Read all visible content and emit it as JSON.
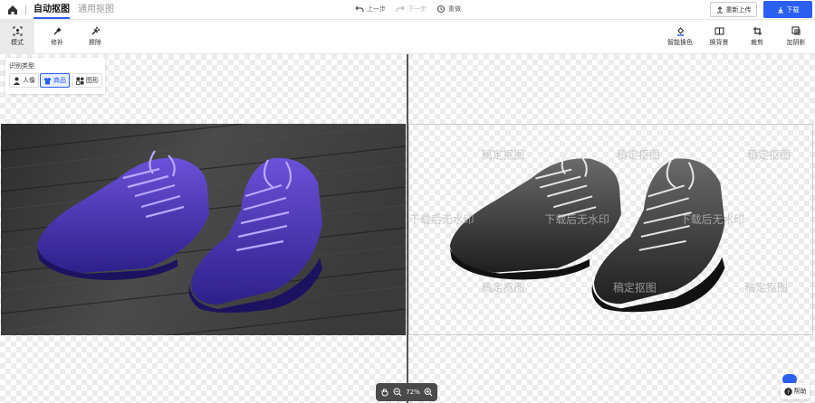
{
  "header": {
    "tabs": [
      {
        "label": "自动抠图",
        "active": true
      },
      {
        "label": "通用抠图",
        "active": false
      }
    ],
    "history": {
      "undo": "上一步",
      "redo": "下一步",
      "reset": "重做"
    },
    "reupload_label": "重新上传",
    "download_label": "下载"
  },
  "toolbar": {
    "left": [
      {
        "label": "模式",
        "icon": "mode-icon",
        "active": true
      },
      {
        "label": "修补",
        "icon": "patch-icon",
        "active": false
      },
      {
        "label": "擦除",
        "icon": "erase-icon",
        "active": false
      }
    ],
    "right": [
      {
        "label": "智能换色",
        "icon": "recolor-icon"
      },
      {
        "label": "换背景",
        "icon": "background-icon"
      },
      {
        "label": "裁剪",
        "icon": "crop-icon"
      },
      {
        "label": "加阴影",
        "icon": "shadow-icon"
      }
    ]
  },
  "recognition": {
    "title": "识别类型",
    "options": [
      {
        "label": "人像",
        "active": false
      },
      {
        "label": "商品",
        "active": true
      },
      {
        "label": "图形",
        "active": false
      }
    ]
  },
  "watermark_texts": [
    "稿定抠图",
    "下载后无水印"
  ],
  "zoom": {
    "value": "72%"
  },
  "help": {
    "label": "帮助"
  },
  "colors": {
    "accent": "#2b5ff0",
    "shoe_left": "#4a32b8",
    "shoe_right": "#3a3a3a"
  }
}
